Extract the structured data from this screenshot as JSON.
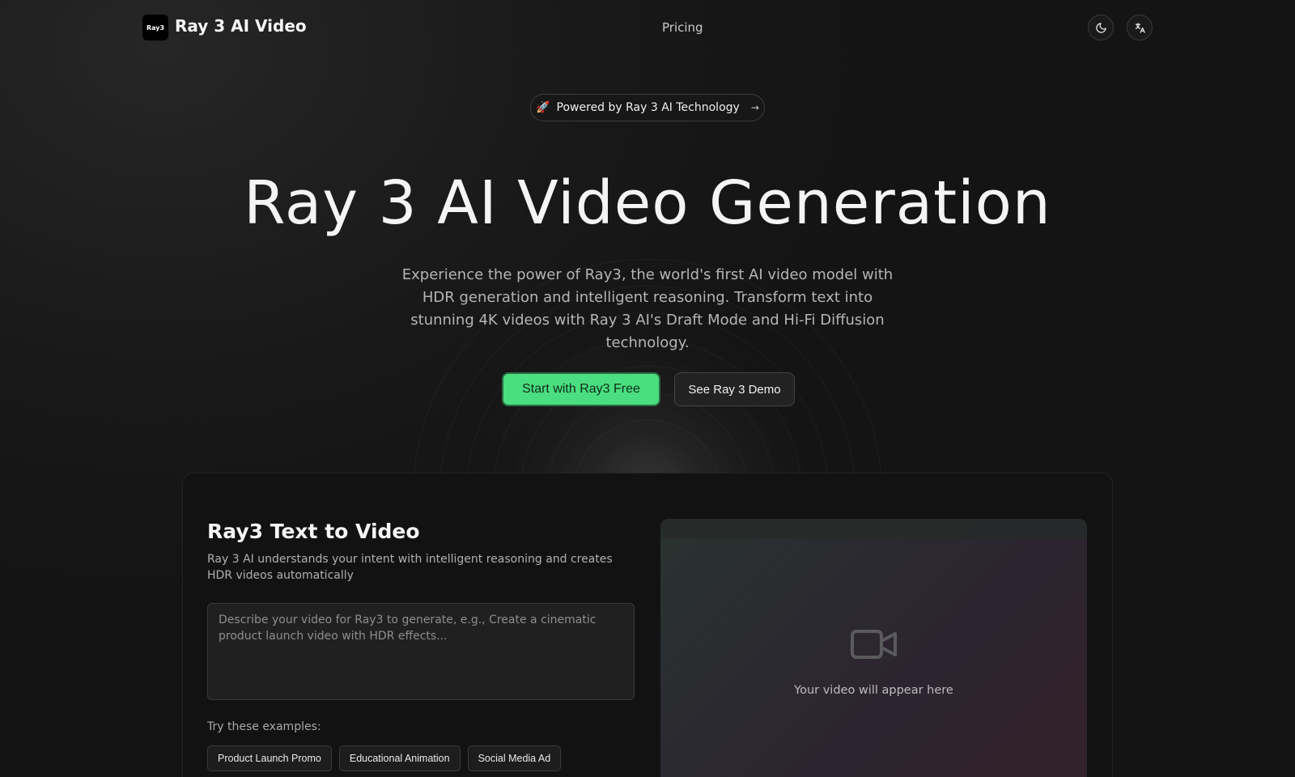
{
  "header": {
    "logo_text": "Ray3",
    "brand": "Ray 3 AI Video",
    "nav": {
      "pricing": "Pricing"
    },
    "icons": {
      "theme": "moon-icon",
      "language": "translate-icon"
    }
  },
  "badge": {
    "emoji": "🚀",
    "text": "Powered by Ray 3 AI Technology",
    "arrow": "→"
  },
  "hero": {
    "title": "Ray 3 AI Video Generation",
    "subtitle": "Experience the power of Ray3, the world's first AI video model with HDR generation and intelligent reasoning. Transform text into stunning 4K videos with Ray 3 AI's Draft Mode and Hi-Fi Diffusion technology.",
    "primary_cta": "Start with Ray3 Free",
    "secondary_cta": "See Ray 3 Demo"
  },
  "generator": {
    "title": "Ray3 Text to Video",
    "description": "Ray 3 AI understands your intent with intelligent reasoning and creates HDR videos automatically",
    "prompt_placeholder": "Describe your video for Ray3 to generate, e.g., Create a cinematic product launch video with HDR effects...",
    "prompt_value": "",
    "examples_label": "Try these examples:",
    "examples": [
      "Product Launch Promo",
      "Educational Animation",
      "Social Media Ad"
    ]
  },
  "preview": {
    "icon": "video-camera-icon",
    "placeholder": "Your video will appear here"
  },
  "colors": {
    "accent": "#4ade80",
    "background": "#151515"
  }
}
